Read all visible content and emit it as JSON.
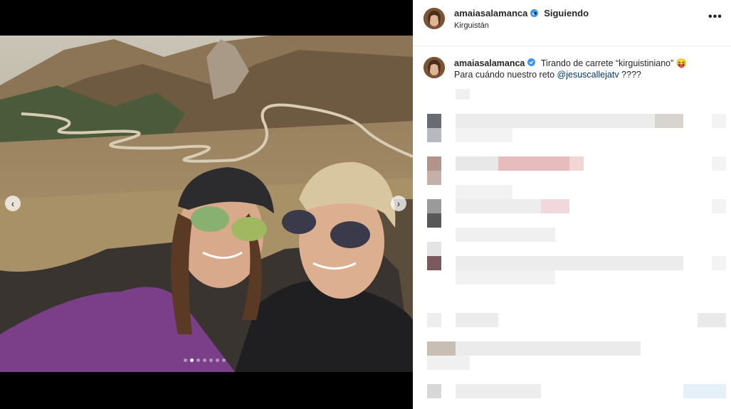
{
  "post": {
    "username": "amaiasalamanca",
    "follow_status": "Siguiendo",
    "follow_separator": "•",
    "location": "Kirguistán",
    "more_label": "•••"
  },
  "caption": {
    "username": "amaiasalamanca",
    "line1": "Tirando de carrete “kirguistiniano” 😝",
    "line2_prefix": "Para cuándo nuestro reto ",
    "mention": "@jesuscallejatv",
    "line2_suffix": " ????"
  },
  "carousel": {
    "prev_icon": "‹",
    "next_icon": "›",
    "slide_count": 7,
    "active_index": 1
  },
  "colors": {
    "verified": "#3897f0",
    "mention": "#00376b",
    "text": "#262626"
  }
}
